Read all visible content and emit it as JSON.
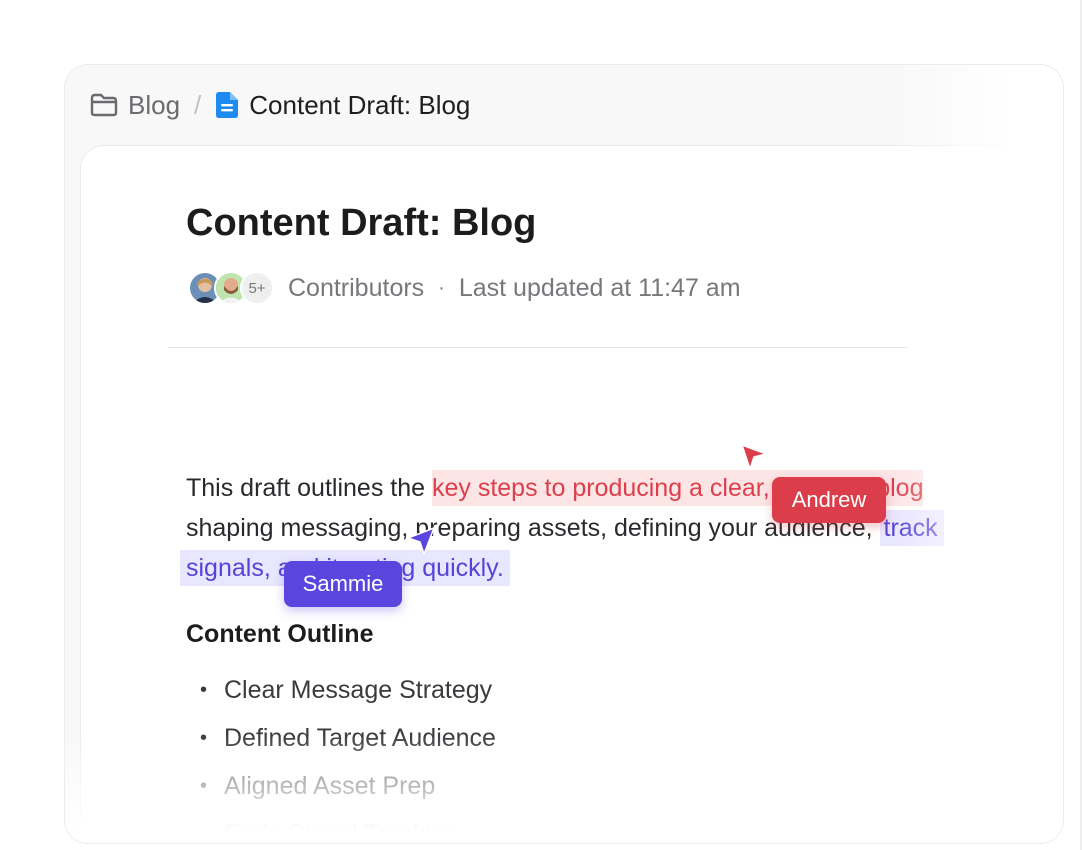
{
  "breadcrumb": {
    "parent": "Blog",
    "separator": "/",
    "current": "Content Draft: Blog",
    "parent_icon": "folder-icon",
    "current_icon": "document-icon",
    "doc_icon_color": "#1e8bf1"
  },
  "document": {
    "title": "Content Draft: Blog",
    "meta": {
      "avatars": [
        "avatar-1",
        "avatar-2"
      ],
      "more_count": "5+",
      "contributors_label": "Contributors",
      "dot": "·",
      "last_updated": "Last updated at 11:47 am"
    },
    "paragraph": {
      "line1_plain": "This draft outlines the ",
      "line1_highlight_red": "key steps to producing a clear, effective blog",
      "line2_plain": "shaping messaging, preparing assets, defining your audience, ",
      "line2_highlight_purple": "track",
      "line3_highlight_purple": "signals, and iterating quickly."
    },
    "outline_heading": "Content Outline",
    "outline_items": [
      "Clear Message Strategy",
      "Defined Target Audience",
      "Aligned Asset Prep",
      "Early Signal Tracking"
    ],
    "bullet": "•"
  },
  "collaborators": {
    "andrew": {
      "name": "Andrew",
      "color": "#db3e4a"
    },
    "sammie": {
      "name": "Sammie",
      "color": "#5a45de"
    }
  }
}
